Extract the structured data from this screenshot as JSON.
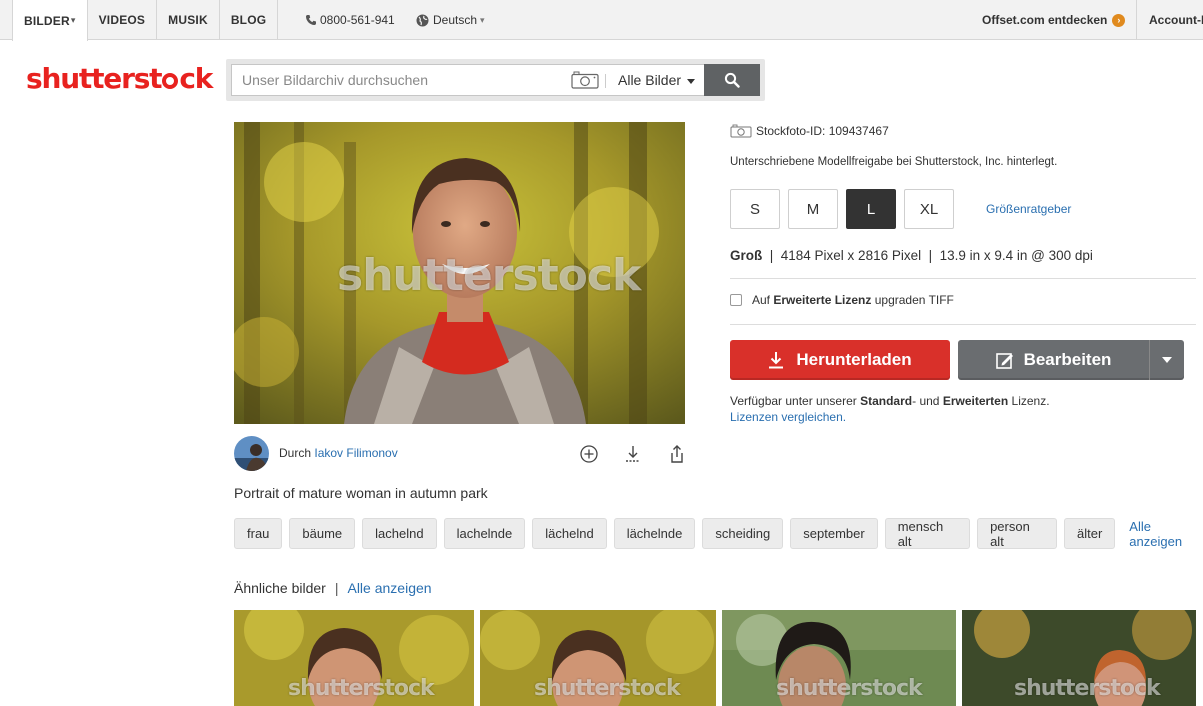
{
  "topnav": {
    "items": [
      {
        "label": "BILDER",
        "caret": "▾"
      },
      {
        "label": "VIDEOS"
      },
      {
        "label": "MUSIK"
      },
      {
        "label": "BLOG"
      }
    ],
    "phone": "0800-561-941",
    "language": "Deutsch",
    "offset_label": "Offset.com entdecken",
    "account_label": "Account-I"
  },
  "logo": {
    "part1": "shutterst",
    "part2": "ck"
  },
  "search": {
    "placeholder": "Unser Bildarchiv durchsuchen",
    "filter": "Alle Bilder"
  },
  "image": {
    "watermark": "shutterstock",
    "author_prefix": "Durch",
    "author_name": "Iakov Filimonov",
    "description": "Portrait of mature woman in autumn park"
  },
  "tags": {
    "items": [
      "frau",
      "bäume",
      "lachelnd",
      "lachelnde",
      "lächelnd",
      "lächelnde",
      "scheiding",
      "september",
      "mensch alt",
      "person alt",
      "älter"
    ],
    "show_all": "Alle anzeigen"
  },
  "similar": {
    "title": "Ähnliche bilder",
    "separator": "|",
    "show_all": "Alle anzeigen",
    "watermark": "shutterstock"
  },
  "details": {
    "stock_id": "Stockfoto-ID: 109437467",
    "release": "Unterschriebene Modellfreigabe bei Shutterstock, Inc. hinterlegt.",
    "sizes": [
      "S",
      "M",
      "L",
      "XL"
    ],
    "selected_size": "L",
    "size_guide": "Größenratgeber",
    "size_name": "Groß",
    "size_pixels": "4184 Pixel x 2816 Pixel",
    "size_inches": "13.9 in x 9.4 in @ 300 dpi",
    "ext_prefix": "Auf",
    "ext_bold": "Erweiterte Lizenz",
    "ext_suffix": "upgraden TIFF",
    "download_label": "Herunterladen",
    "edit_label": "Bearbeiten",
    "avail_prefix": "Verfügbar unter unserer",
    "avail_standard": "Standard",
    "avail_mid": "- und",
    "avail_extended": "Erweiterten",
    "avail_suffix": "Lizenz.",
    "compare_link": "Lizenzen vergleichen."
  },
  "colors": {
    "brand_red": "#e8221f",
    "download_red": "#d9302a",
    "edit_gray": "#6a6d70",
    "link_blue": "#2a6fb0"
  }
}
